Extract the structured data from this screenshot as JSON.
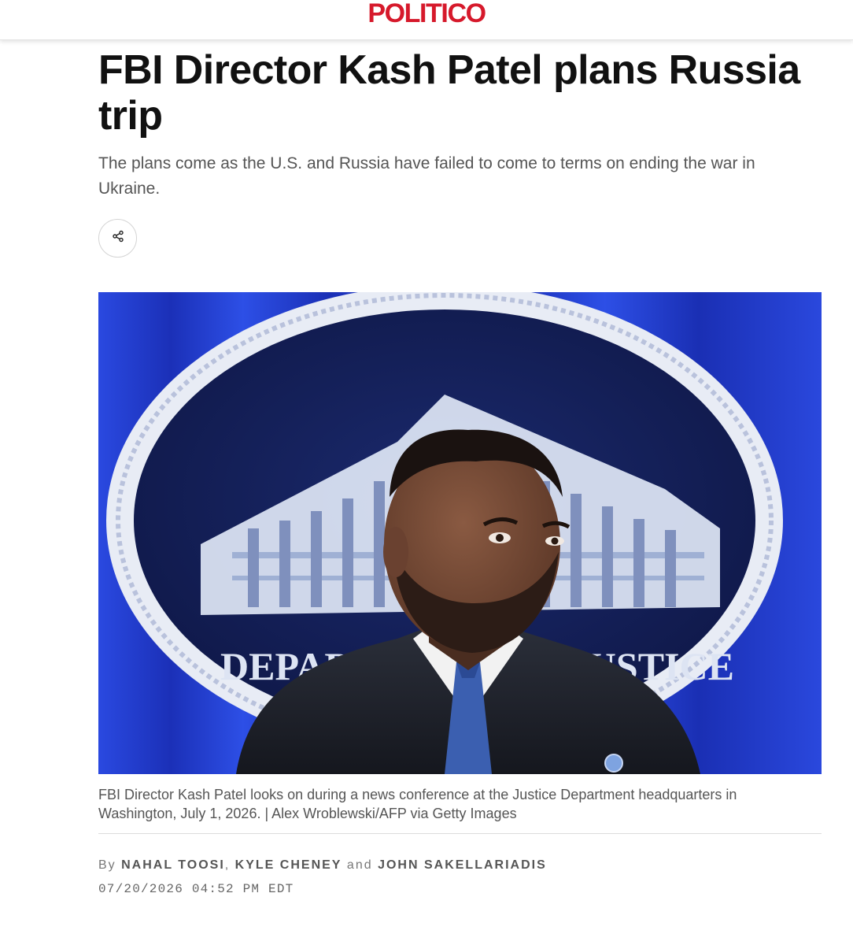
{
  "header": {
    "logo_text": "POLITICO",
    "brand_color": "#d6192b"
  },
  "article": {
    "headline": "FBI Director Kash Patel plans Russia trip",
    "dek": "The plans come as the U.S. and Russia have failed to come to terms on ending the war in Ukraine.",
    "share_icon": "share-icon",
    "image": {
      "seal_text": "DEPARTMENT OF JUSTICE",
      "background_color": "#1d34c9"
    },
    "caption": "FBI Director Kash Patel looks on during a news conference at the Justice Department headquarters in Washington, July 1, 2026. | Alex Wroblewski/AFP via Getty Images",
    "byline": {
      "prefix": "By",
      "authors": [
        "NAHAL TOOSI",
        "KYLE CHENEY",
        "JOHN SAKELLARIADIS"
      ],
      "separator": ",",
      "conjunction": "and"
    },
    "timestamp": "07/20/2026 04:52 PM EDT"
  }
}
